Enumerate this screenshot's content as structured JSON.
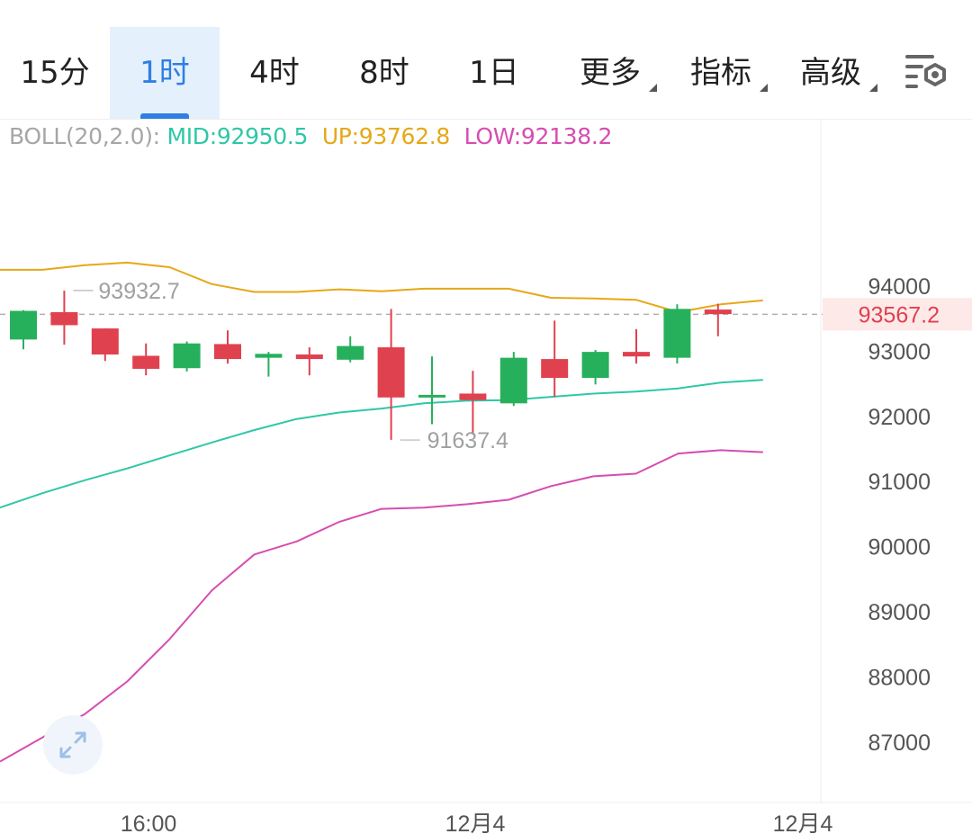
{
  "tabs": [
    {
      "label": "15分",
      "active": false
    },
    {
      "label": "1时",
      "active": true
    },
    {
      "label": "4时",
      "active": false
    },
    {
      "label": "8时",
      "active": false
    },
    {
      "label": "1日",
      "active": false
    },
    {
      "label": "更多",
      "active": false,
      "dropdown": true
    },
    {
      "label": "指标",
      "active": false,
      "dropdown": true
    },
    {
      "label": "高级",
      "active": false,
      "dropdown": true
    }
  ],
  "settings_icon": "chart-settings-icon",
  "expand_icon": "expand-arrows-icon",
  "indicator": {
    "label": "BOLL(20,2.0):",
    "mid": "MID:92950.5",
    "up": "UP:93762.8",
    "low": "LOW:92138.2"
  },
  "colors": {
    "accent": "#2f7fe3",
    "mid_line": "#2fc7a7",
    "up_line": "#e6a817",
    "low_line": "#d64db0",
    "rise": "#27b05c",
    "fall": "#e0414f",
    "price_tag_bg": "#fde9e8"
  },
  "chart_data": {
    "type": "candlestick",
    "ylim": [
      86300,
      94900
    ],
    "y_ticks": [
      94000,
      93000,
      92000,
      91000,
      90000,
      89000,
      88000,
      87000
    ],
    "x_tick_labels": [
      "16:00",
      "12月4",
      "12月4"
    ],
    "current_price": "93567.2",
    "current_price_value": 93567.2,
    "high_marker": {
      "label": "93932.7",
      "value": 93932.7
    },
    "low_marker": {
      "label": "91637.4",
      "value": 91637.4
    },
    "candles": [
      {
        "o": 93180,
        "h": 93630,
        "l": 93030,
        "c": 93620
      },
      {
        "o": 93600,
        "h": 93930,
        "l": 93100,
        "c": 93400
      },
      {
        "o": 93350,
        "h": 93350,
        "l": 92850,
        "c": 92950
      },
      {
        "o": 92930,
        "h": 93120,
        "l": 92630,
        "c": 92730
      },
      {
        "o": 92740,
        "h": 93150,
        "l": 92690,
        "c": 93120
      },
      {
        "o": 93110,
        "h": 93320,
        "l": 92810,
        "c": 92880
      },
      {
        "o": 92900,
        "h": 92990,
        "l": 92610,
        "c": 92960
      },
      {
        "o": 92950,
        "h": 93060,
        "l": 92630,
        "c": 92880
      },
      {
        "o": 92870,
        "h": 93230,
        "l": 92830,
        "c": 93080
      },
      {
        "o": 93060,
        "h": 93650,
        "l": 91640,
        "c": 92290
      },
      {
        "o": 92330,
        "h": 92920,
        "l": 91880,
        "c": 92330
      },
      {
        "o": 92350,
        "h": 92700,
        "l": 91720,
        "c": 92250
      },
      {
        "o": 92200,
        "h": 92990,
        "l": 92160,
        "c": 92900
      },
      {
        "o": 92880,
        "h": 93470,
        "l": 92300,
        "c": 92590
      },
      {
        "o": 92590,
        "h": 93020,
        "l": 92490,
        "c": 92990
      },
      {
        "o": 92990,
        "h": 93340,
        "l": 92810,
        "c": 92920
      },
      {
        "o": 92900,
        "h": 93720,
        "l": 92810,
        "c": 93650
      },
      {
        "o": 93640,
        "h": 93730,
        "l": 93230,
        "c": 93570
      }
    ],
    "series": [
      {
        "name": "UP",
        "values": [
          94250,
          94250,
          94320,
          94360,
          94290,
          94030,
          93910,
          93910,
          93950,
          93920,
          93960,
          93960,
          93960,
          93820,
          93810,
          93790,
          93600,
          93720,
          93780
        ]
      },
      {
        "name": "MID",
        "values": [
          90600,
          90820,
          91020,
          91200,
          91400,
          91600,
          91790,
          91960,
          92060,
          92120,
          92200,
          92240,
          92250,
          92300,
          92350,
          92380,
          92430,
          92520,
          92560
        ]
      },
      {
        "name": "LOW",
        "values": [
          86700,
          87070,
          87430,
          87930,
          88580,
          89330,
          89880,
          90080,
          90380,
          90580,
          90600,
          90650,
          90720,
          90930,
          91080,
          91120,
          91430,
          91480,
          91450
        ]
      }
    ]
  }
}
